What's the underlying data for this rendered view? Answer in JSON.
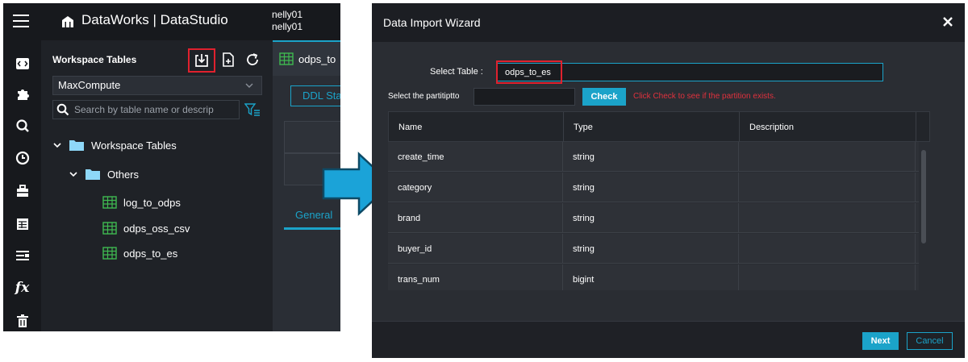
{
  "app": {
    "brand": "DataWorks | DataStudio",
    "user_line1": "nelly01",
    "user_line2": "nelly01"
  },
  "activity_bar": [
    "menu-icon",
    "code-icon",
    "puzzle-icon",
    "search-icon",
    "clock-icon",
    "toolbox-icon",
    "table-icon",
    "list-icon",
    "function-icon",
    "trash-icon"
  ],
  "panel": {
    "title": "Workspace Tables",
    "engine": "MaxCompute",
    "search_placeholder": "Search by table name or descrip",
    "tree": {
      "root": "Workspace Tables",
      "folder": "Others",
      "tables": [
        "log_to_odps",
        "odps_oss_csv",
        "odps_to_es"
      ]
    }
  },
  "editor": {
    "tab_label": "odps_to",
    "ddl_button": "DDL Sta",
    "general_tab": "General"
  },
  "dialog": {
    "title": "Data Import Wizard",
    "select_table_label": "Select Table :",
    "select_table_value": "odps_to_es",
    "partition_label": "Select the partitiptto",
    "check_button": "Check",
    "check_hint": "Click Check to see if the partition exists.",
    "columns": [
      "Name",
      "Type",
      "Description"
    ],
    "rows": [
      {
        "name": "create_time",
        "type": "string",
        "description": ""
      },
      {
        "name": "category",
        "type": "string",
        "description": ""
      },
      {
        "name": "brand",
        "type": "string",
        "description": ""
      },
      {
        "name": "buyer_id",
        "type": "string",
        "description": ""
      },
      {
        "name": "trans_num",
        "type": "bigint",
        "description": ""
      }
    ],
    "next_button": "Next",
    "cancel_button": "Cancel"
  },
  "colors": {
    "accent": "#1ba3c9",
    "highlight": "#e0212e",
    "hint": "#e0313d",
    "folder": "#8ed8f8",
    "table_icon": "#3fb950"
  }
}
